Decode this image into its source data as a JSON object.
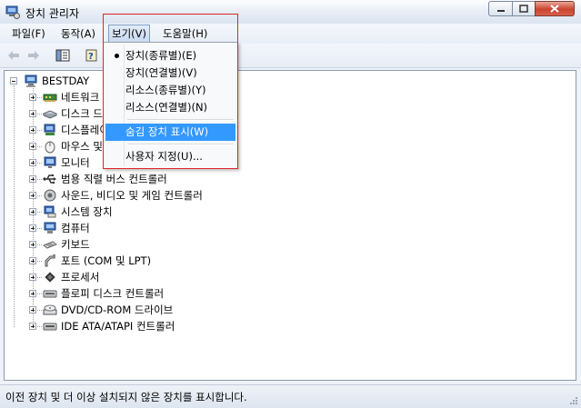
{
  "window": {
    "title": "장치 관리자"
  },
  "menubar": {
    "items": [
      {
        "label": "파일(F)"
      },
      {
        "label": "동작(A)"
      },
      {
        "label": "보기(V)"
      },
      {
        "label": "도움말(H)"
      }
    ]
  },
  "tree": {
    "root": "BESTDAY",
    "items": [
      {
        "label": "네트워크 어댑터",
        "icon": "network-adapter-icon"
      },
      {
        "label": "디스크 드라이브",
        "icon": "disk-drive-icon"
      },
      {
        "label": "디스플레이 어댑터",
        "icon": "display-adapter-icon"
      },
      {
        "label": "마우스 및 기타 포인팅 장치",
        "icon": "mouse-icon"
      },
      {
        "label": "모니터",
        "icon": "monitor-icon"
      },
      {
        "label": "범용 직렬 버스 컨트롤러",
        "icon": "usb-icon"
      },
      {
        "label": "사운드, 비디오 및 게임 컨트롤러",
        "icon": "sound-icon"
      },
      {
        "label": "시스템 장치",
        "icon": "system-device-icon"
      },
      {
        "label": "컴퓨터",
        "icon": "computer-icon"
      },
      {
        "label": "키보드",
        "icon": "keyboard-icon"
      },
      {
        "label": "포트 (COM 및 LPT)",
        "icon": "port-icon"
      },
      {
        "label": "프로세서",
        "icon": "processor-icon"
      },
      {
        "label": "플로피 디스크 컨트롤러",
        "icon": "floppy-controller-icon"
      },
      {
        "label": "DVD/CD-ROM 드라이브",
        "icon": "dvd-drive-icon"
      },
      {
        "label": "IDE ATA/ATAPI 컨트롤러",
        "icon": "ide-controller-icon"
      }
    ]
  },
  "view_menu": {
    "items": [
      {
        "label": "장치(종류별)(E)",
        "checked": true
      },
      {
        "label": "장치(연결별)(V)"
      },
      {
        "label": "리소스(종류별)(Y)"
      },
      {
        "label": "리소스(연결별)(N)"
      },
      {
        "label": "숨김 장치 표시(W)",
        "highlighted": true
      },
      {
        "label": "사용자 지정(U)..."
      }
    ]
  },
  "statusbar": {
    "text": "이전 장치 및 더 이상 설치되지 않은 장치를 표시합니다."
  },
  "colors": {
    "highlight": "#3399ff",
    "frame": "#e0242a"
  }
}
